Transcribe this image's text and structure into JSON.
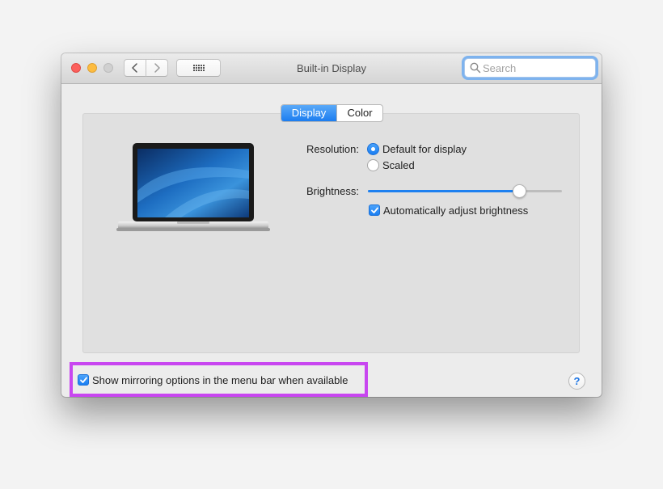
{
  "window": {
    "title": "Built-in Display"
  },
  "search": {
    "placeholder": "Search",
    "value": ""
  },
  "tabs": [
    {
      "label": "Display",
      "active": true
    },
    {
      "label": "Color",
      "active": false
    }
  ],
  "resolution": {
    "label": "Resolution:",
    "options": [
      {
        "label": "Default for display",
        "selected": true
      },
      {
        "label": "Scaled",
        "selected": false
      }
    ]
  },
  "brightness": {
    "label": "Brightness:",
    "value_fraction": 0.78,
    "auto_adjust": {
      "label": "Automatically adjust brightness",
      "checked": true
    }
  },
  "mirroring": {
    "label": "Show mirroring options in the menu bar when available",
    "checked": true
  },
  "help": {
    "label": "?"
  },
  "icons": [
    "close-button",
    "minimize-button",
    "zoom-button",
    "chevron-left-icon",
    "chevron-right-icon",
    "grid-icon",
    "search-icon",
    "checkmark-icon",
    "help-icon"
  ],
  "colors": {
    "accent": "#1c7df0",
    "highlight": "#c846f0"
  }
}
